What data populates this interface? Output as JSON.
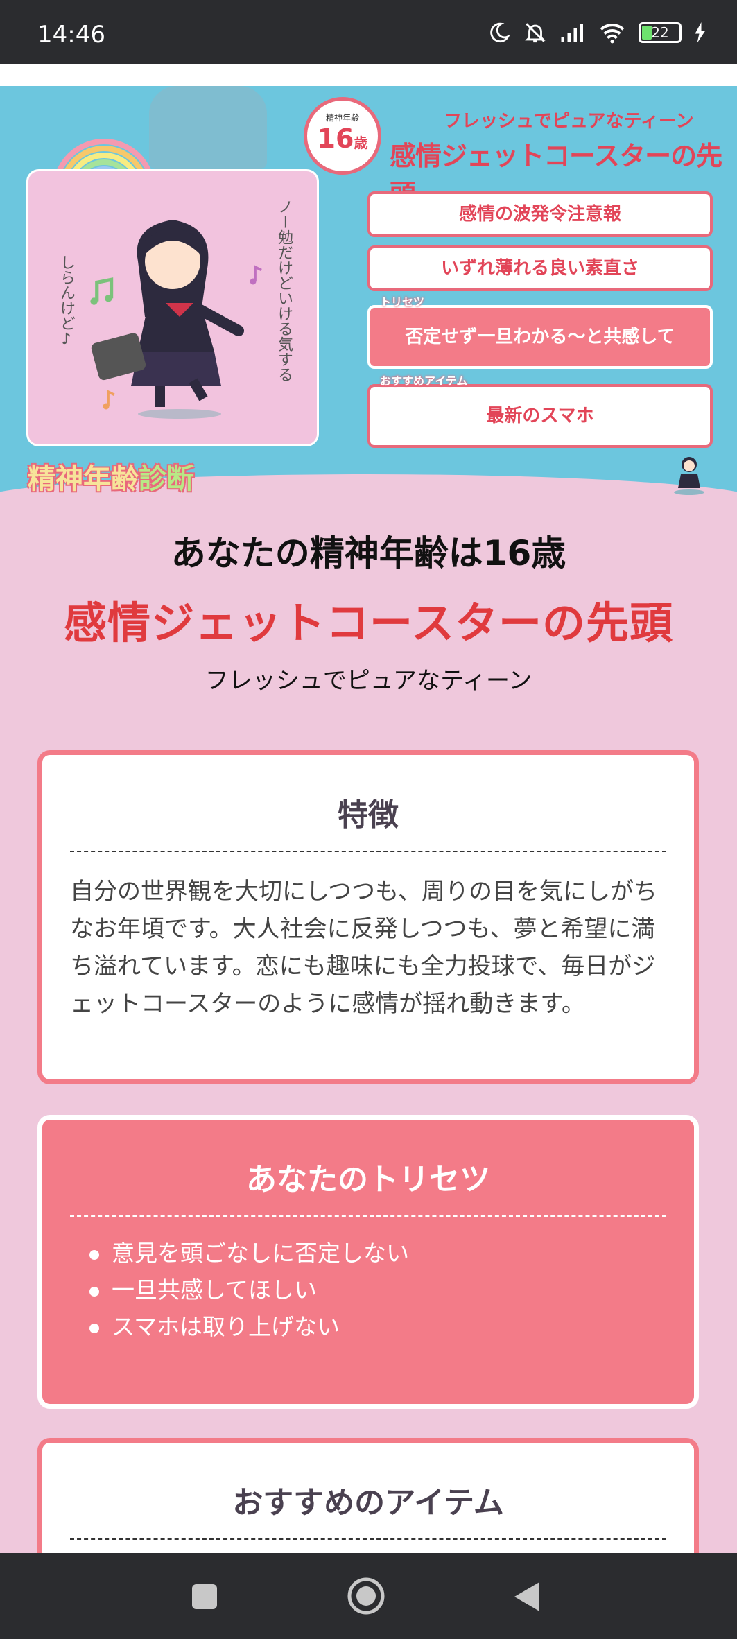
{
  "status_bar": {
    "time": "14:46",
    "battery": "22"
  },
  "banner": {
    "age_badge_small": "精神年齢",
    "age_badge_value": "16",
    "age_badge_unit": "歳",
    "subtitle": "フレッシュでピュアなティーン",
    "title": "感情ジェットコースターの先頭",
    "box1": "感情の波発令注意報",
    "box2": "いずれ薄れる良い素直さ",
    "box3_tag": "トリセツ",
    "box3": "否定せず一旦わかる〜と共感して",
    "box4_tag": "おすすめアイテム",
    "box4": "最新のスマホ",
    "logo_main": "精神年齢",
    "logo_accent": "診断",
    "illust_text_right": "ノー勉だけどいける気する",
    "illust_text_left": "しらんけど♪"
  },
  "result": {
    "age_line": "あなたの精神年齢は16歳",
    "type": "感情ジェットコースターの先頭",
    "subtitle": "フレッシュでピュアなティーン"
  },
  "features": {
    "title": "特徴",
    "body": "自分の世界観を大切にしつつも、周りの目を気にしがちなお年頃です。大人社会に反発しつつも、夢と希望に満ち溢れています。恋にも趣味にも全力投球で、毎日がジェットコースターのように感情が揺れ動きます。"
  },
  "torisetsu": {
    "title": "あなたのトリセツ",
    "items": [
      "意見を頭ごなしに否定しない",
      "一旦共感してほしい",
      "スマホは取り上げない"
    ]
  },
  "items_section": {
    "title": "おすすめのアイテム"
  },
  "colors": {
    "banner_bg": "#6cc6de",
    "page_bg": "#efc8dc",
    "accent": "#e03a3e",
    "section_pink": "#f37b88"
  }
}
